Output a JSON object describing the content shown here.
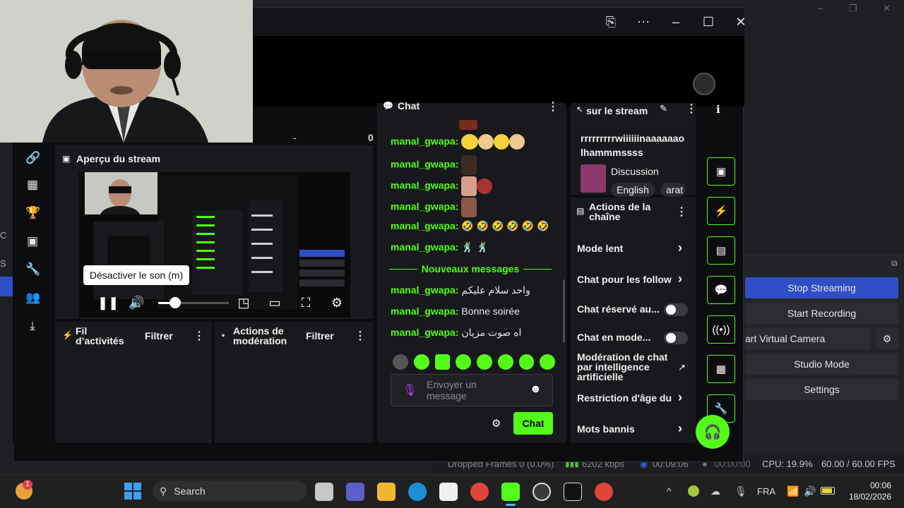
{
  "obs": {
    "window_controls": [
      "–",
      "❐",
      "✕"
    ],
    "buttons": {
      "stop_streaming": "Stop Streaming",
      "start_recording": "Start Recording",
      "virtual_camera": "art Virtual Camera",
      "studio_mode": "Studio Mode",
      "settings": "Settings"
    },
    "status": {
      "dropped_frames": "Dropped Frames 0 (0.0%)",
      "bitrate": "6202 kbps",
      "stream_time": "00:09:06",
      "rec_time": "00:00:00",
      "cpu": "CPU: 19.9%",
      "fps": "60.00 / 60.00 FPS"
    }
  },
  "kick": {
    "preview": {
      "title": "Aperçu du stream",
      "tooltip": "Désactiver le son (m)"
    },
    "activity": {
      "title": "Fil d’activités",
      "filter": "Filtrer"
    },
    "moderation": {
      "title": "Actions de modération",
      "filter": "Filtrer"
    },
    "chat": {
      "title": "Chat",
      "lines": [
        {
          "user": "manal_gwapa",
          "msg": ""
        },
        {
          "user": "manal_gwapa",
          "msg": ""
        },
        {
          "user": "manal_gwapa",
          "msg": ""
        },
        {
          "user": "manal_gwapa",
          "msg": ""
        },
        {
          "user": "manal_gwapa",
          "msg": ""
        },
        {
          "user": "manal_gwapa",
          "msg": "🤣 🤣 🤣 🤣 🤣 🤣"
        },
        {
          "user": "manal_gwapa",
          "msg": "🕺 🕺"
        }
      ],
      "new_messages": "Nouveaux messages",
      "new_lines": [
        {
          "user": "manal_gwapa",
          "msg": "واحد سلام عليكم"
        },
        {
          "user": "manal_gwapa",
          "msg": "Bonne soirée"
        },
        {
          "user": "manal_gwapa",
          "msg": "اه صوت مزيان"
        }
      ],
      "input_placeholder": "Envoyer un message",
      "send": "Chat"
    },
    "stream_info": {
      "title": "sur le stream",
      "stream_title": "rrrrrrrrrwiiiiiinaaaaaao lhammmssss",
      "category": "Discussion",
      "tags": [
        "English",
        "arat"
      ]
    },
    "actions": {
      "title": "Actions de la chaîne",
      "items": [
        {
          "label": "Mode lent",
          "type": "chevron"
        },
        {
          "label": "Chat pour les follow",
          "type": "chevron"
        },
        {
          "label": "Chat réservé au...",
          "type": "toggle"
        },
        {
          "label": "Chat en mode...",
          "type": "toggle"
        },
        {
          "label": "Modération de chat par intelligence artificielle",
          "type": "external"
        },
        {
          "label": "Restriction d'âge du",
          "type": "chevron"
        },
        {
          "label": "Mots bannis",
          "type": "chevron"
        }
      ]
    },
    "preview_stats": {
      "counter_left": "-",
      "counter_right": "0"
    }
  },
  "taskbar": {
    "search": "Search",
    "lang": "FRA",
    "time": "00:06",
    "date": "18/02/2026",
    "badge": "1"
  },
  "colors": {
    "kick_green": "#53fc18",
    "obs_blue": "#2f4fc7"
  }
}
